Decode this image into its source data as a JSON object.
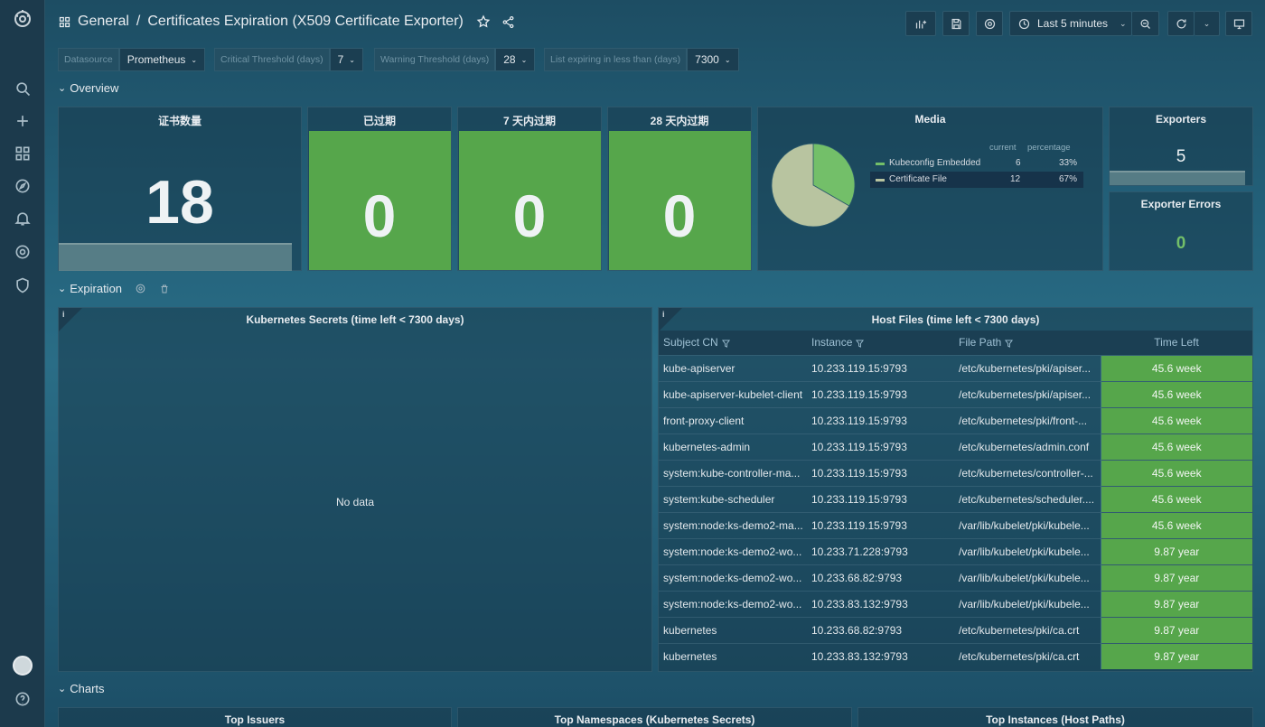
{
  "breadcrumb": {
    "folder": "General",
    "separator": "/",
    "title": "Certificates Expiration (X509 Certificate Exporter)"
  },
  "toolbar": {
    "time_range": "Last 5 minutes"
  },
  "variables": [
    {
      "label": "Datasource",
      "value": "Prometheus"
    },
    {
      "label": "Critical Threshold (days)",
      "value": "7"
    },
    {
      "label": "Warning Threshold (days)",
      "value": "28"
    },
    {
      "label": "List expiring in less than (days)",
      "value": "7300"
    }
  ],
  "rows": {
    "overview": "Overview",
    "expiration": "Expiration",
    "charts": "Charts"
  },
  "overview": {
    "total": {
      "title": "证书数量",
      "value": "18"
    },
    "expired": {
      "title": "已过期",
      "value": "0"
    },
    "expiring7": {
      "title": "7 天内过期",
      "value": "0"
    },
    "expiring28": {
      "title": "28 天内过期",
      "value": "0"
    },
    "media": {
      "title": "Media",
      "col_current": "current",
      "col_percentage": "percentage",
      "items": [
        {
          "name": "Kubeconfig Embedded",
          "current": "6",
          "percentage": "33%",
          "color": "#73bf69"
        },
        {
          "name": "Certificate File",
          "current": "12",
          "percentage": "67%",
          "color": "#b8c4a0"
        }
      ]
    },
    "exporters": {
      "title": "Exporters",
      "value": "5"
    },
    "exporter_errors": {
      "title": "Exporter Errors",
      "value": "0"
    }
  },
  "chart_data": {
    "type": "pie",
    "title": "Media",
    "categories": [
      "Kubeconfig Embedded",
      "Certificate File"
    ],
    "values": [
      6,
      12
    ],
    "colors": [
      "#73bf69",
      "#b8c4a0"
    ],
    "legend": "right"
  },
  "expiration": {
    "k8s_secrets": {
      "title": "Kubernetes Secrets (time left < 7300 days)",
      "empty": "No data",
      "info": "i"
    },
    "host_files": {
      "title": "Host Files (time left < 7300 days)",
      "info": "i",
      "columns": [
        "Subject CN",
        "Instance",
        "File Path",
        "Time Left"
      ],
      "rows": [
        [
          "kube-apiserver",
          "10.233.119.15:9793",
          "/etc/kubernetes/pki/apiser...",
          "45.6 week"
        ],
        [
          "kube-apiserver-kubelet-client",
          "10.233.119.15:9793",
          "/etc/kubernetes/pki/apiser...",
          "45.6 week"
        ],
        [
          "front-proxy-client",
          "10.233.119.15:9793",
          "/etc/kubernetes/pki/front-...",
          "45.6 week"
        ],
        [
          "kubernetes-admin",
          "10.233.119.15:9793",
          "/etc/kubernetes/admin.conf",
          "45.6 week"
        ],
        [
          "system:kube-controller-ma...",
          "10.233.119.15:9793",
          "/etc/kubernetes/controller-...",
          "45.6 week"
        ],
        [
          "system:kube-scheduler",
          "10.233.119.15:9793",
          "/etc/kubernetes/scheduler....",
          "45.6 week"
        ],
        [
          "system:node:ks-demo2-ma...",
          "10.233.119.15:9793",
          "/var/lib/kubelet/pki/kubele...",
          "45.6 week"
        ],
        [
          "system:node:ks-demo2-wo...",
          "10.233.71.228:9793",
          "/var/lib/kubelet/pki/kubele...",
          "9.87 year"
        ],
        [
          "system:node:ks-demo2-wo...",
          "10.233.68.82:9793",
          "/var/lib/kubelet/pki/kubele...",
          "9.87 year"
        ],
        [
          "system:node:ks-demo2-wo...",
          "10.233.83.132:9793",
          "/var/lib/kubelet/pki/kubele...",
          "9.87 year"
        ],
        [
          "kubernetes",
          "10.233.68.82:9793",
          "/etc/kubernetes/pki/ca.crt",
          "9.87 year"
        ],
        [
          "kubernetes",
          "10.233.83.132:9793",
          "/etc/kubernetes/pki/ca.crt",
          "9.87 year"
        ]
      ]
    }
  },
  "charts": {
    "top_issuers": "Top Issuers",
    "top_namespaces": "Top Namespaces (Kubernetes Secrets)",
    "top_instances": "Top Instances (Host Paths)"
  }
}
